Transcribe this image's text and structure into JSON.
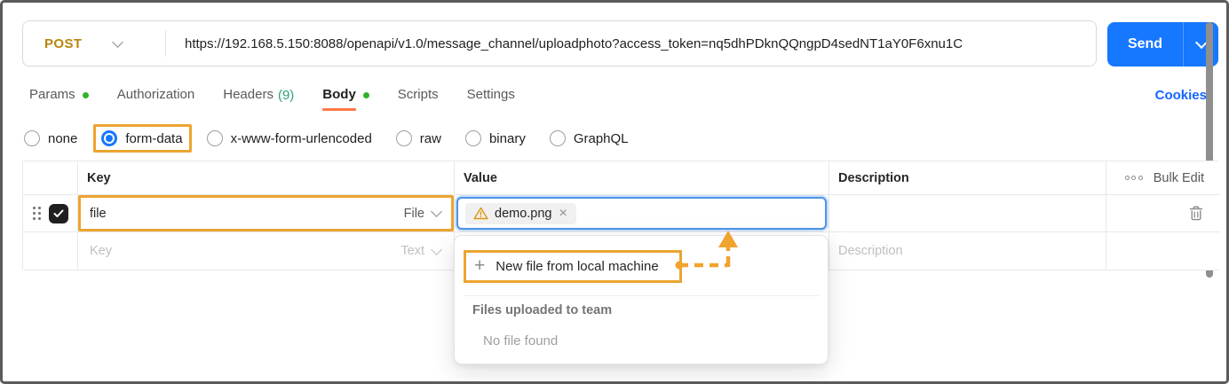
{
  "request": {
    "method": "POST",
    "url": "https://192.168.5.150:8088/openapi/v1.0/message_channel/uploadphoto?access_token=nq5dhPDknQQngpD4sedNT1aY0F6xnu1C",
    "send_label": "Send"
  },
  "tabs": [
    {
      "label": "Params",
      "dot": true
    },
    {
      "label": "Authorization"
    },
    {
      "label": "Headers",
      "count": "(9)"
    },
    {
      "label": "Body",
      "dot": true,
      "active": true
    },
    {
      "label": "Scripts"
    },
    {
      "label": "Settings"
    }
  ],
  "cookies_label": "Cookies",
  "body_types": [
    {
      "label": "none",
      "selected": false
    },
    {
      "label": "form-data",
      "selected": true,
      "annotated": true
    },
    {
      "label": "x-www-form-urlencoded",
      "selected": false
    },
    {
      "label": "raw",
      "selected": false
    },
    {
      "label": "binary",
      "selected": false
    },
    {
      "label": "GraphQL",
      "selected": false
    }
  ],
  "table": {
    "headers": {
      "key": "Key",
      "value": "Value",
      "description": "Description"
    },
    "bulk_edit_label": "Bulk Edit",
    "row1": {
      "key": "file",
      "type": "File",
      "file_chip": "demo.png",
      "checked": true
    },
    "row2": {
      "key_placeholder": "Key",
      "type": "Text",
      "description_placeholder": "Description"
    }
  },
  "file_dropdown": {
    "new_file_label": "New file from local machine",
    "section_title": "Files uploaded to team",
    "empty_text": "No file found"
  },
  "icons": {
    "plus": "+",
    "close": "×"
  },
  "colors": {
    "accent_blue": "#1677ff",
    "annotation_orange": "#eca430",
    "method_gold": "#b8860b",
    "green_dot": "#31b329",
    "headers_count_green": "#2ba471",
    "active_tab_underline": "#ff7847",
    "focus_ring_blue": "#4c94e8"
  }
}
